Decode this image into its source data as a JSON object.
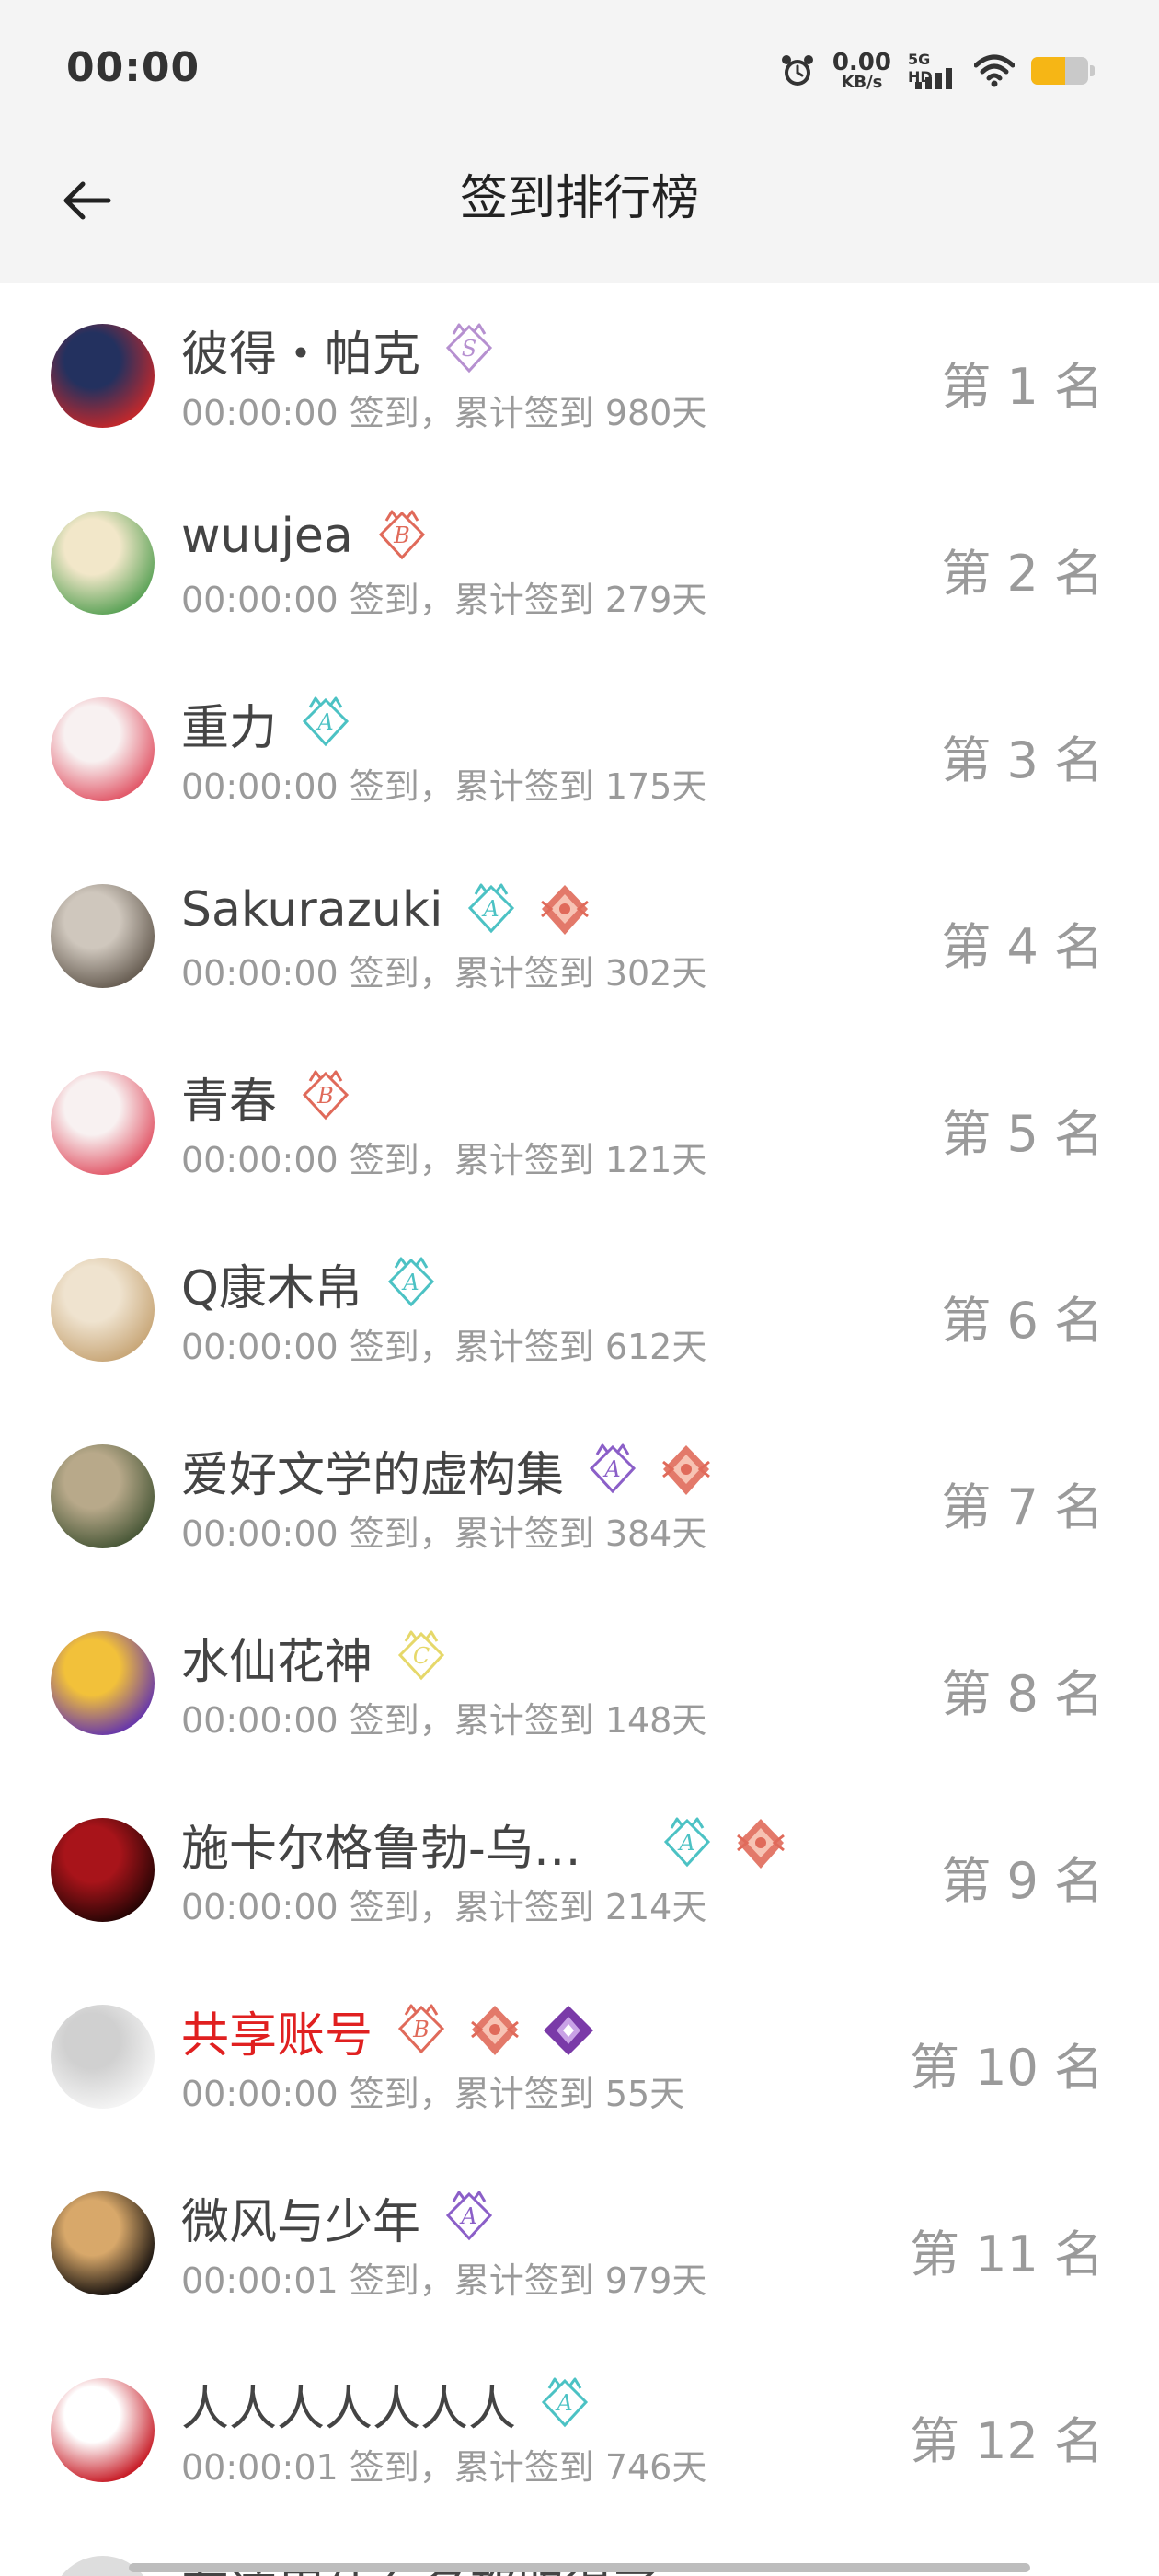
{
  "status_bar": {
    "time": "00:00",
    "net_speed_value": "0.00",
    "net_speed_unit": "KB/s",
    "signal_label": "5G HD",
    "battery_level": 0.6,
    "battery_color": "#f6b615",
    "icons": [
      "alarm-icon",
      "signal-icon",
      "wifi-icon",
      "battery-icon"
    ]
  },
  "header": {
    "back_icon": "arrow-left-icon",
    "title": "签到排行榜"
  },
  "ranking": [
    {
      "name": "彼得・帕克",
      "badges": [
        {
          "type": "rank",
          "letter": "S",
          "color": "#b690d0"
        }
      ],
      "sub": "00:00:00 签到，累计签到 980天",
      "rank": "第 1 名",
      "avatar_colors": [
        "#c0282c",
        "#23315f"
      ]
    },
    {
      "name": "wuujea",
      "badges": [
        {
          "type": "rank",
          "letter": "B",
          "color": "#e06a5a"
        }
      ],
      "sub": "00:00:00 签到，累计签到 279天",
      "rank": "第 2 名",
      "avatar_colors": [
        "#5fa45a",
        "#f2e7c9"
      ]
    },
    {
      "name": "重力",
      "badges": [
        {
          "type": "rank",
          "letter": "A",
          "color": "#4cc2c4"
        }
      ],
      "sub": "00:00:00 签到，累计签到 175天",
      "rank": "第 3 名",
      "avatar_colors": [
        "#e25c6c",
        "#f8f1f1"
      ]
    },
    {
      "name": "Sakurazuki",
      "badges": [
        {
          "type": "rank",
          "letter": "A",
          "color": "#4cc2c4"
        },
        {
          "type": "medal",
          "color": "#e06a5a"
        }
      ],
      "sub": "00:00:00 签到，累计签到 302天",
      "rank": "第 4 名",
      "avatar_colors": [
        "#6a6055",
        "#cfc7bd"
      ]
    },
    {
      "name": "青春",
      "badges": [
        {
          "type": "rank",
          "letter": "B",
          "color": "#e06a5a"
        }
      ],
      "sub": "00:00:00 签到，累计签到 121天",
      "rank": "第 5 名",
      "avatar_colors": [
        "#e25c6c",
        "#f8f1f1"
      ]
    },
    {
      "name": "Q康木帛",
      "badges": [
        {
          "type": "rank",
          "letter": "A",
          "color": "#4cc2c4"
        }
      ],
      "sub": "00:00:00 签到，累计签到 612天",
      "rank": "第 6 名",
      "avatar_colors": [
        "#c9a87a",
        "#efe3cf"
      ]
    },
    {
      "name": "爱好文学的虚构集",
      "badges": [
        {
          "type": "rank",
          "letter": "A",
          "color": "#8b5fc8"
        },
        {
          "type": "medal",
          "color": "#e06a5a"
        }
      ],
      "sub": "00:00:00 签到，累计签到 384天",
      "rank": "第 7 名",
      "avatar_colors": [
        "#4c5a3a",
        "#b8a98a"
      ]
    },
    {
      "name": "水仙花神",
      "badges": [
        {
          "type": "rank",
          "letter": "C",
          "color": "#e6d86a"
        }
      ],
      "sub": "00:00:00 签到，累计签到 148天",
      "rank": "第 8 名",
      "avatar_colors": [
        "#6a3aa8",
        "#f2c13a"
      ]
    },
    {
      "name": "施卡尔格鲁勃-乌…",
      "badges": [
        {
          "type": "rank",
          "letter": "A",
          "color": "#4cc2c4"
        },
        {
          "type": "medal",
          "color": "#e06a5a"
        }
      ],
      "sub": "00:00:00 签到，累计签到 214天",
      "rank": "第 9 名",
      "avatar_colors": [
        "#2a0505",
        "#a8141a"
      ],
      "badges_far": true
    },
    {
      "name": "共享账号",
      "name_color": "red",
      "badges": [
        {
          "type": "rank",
          "letter": "B",
          "color": "#e06a5a"
        },
        {
          "type": "medal",
          "color": "#e06a5a"
        },
        {
          "type": "gem",
          "color": "#7a3aa8"
        }
      ],
      "sub": "00:00:00 签到，累计签到 55天",
      "rank": "第 10 名",
      "avatar_colors": [
        "#f4f4f4",
        "#d0d0d0"
      ]
    },
    {
      "name": "微风与少年",
      "badges": [
        {
          "type": "rank",
          "letter": "A",
          "color": "#8b5fc8"
        }
      ],
      "sub": "00:00:01 签到，累计签到 979天",
      "rank": "第 11 名",
      "avatar_colors": [
        "#1a1410",
        "#d8a86a"
      ]
    },
    {
      "name": "人人人人人人人",
      "badges": [
        {
          "type": "rank",
          "letter": "A",
          "color": "#4cc2c4"
        }
      ],
      "sub": "00:00:01 签到，累计签到 746天",
      "rank": "第 12 名",
      "avatar_colors": [
        "#c8202a",
        "#ffffff"
      ]
    }
  ],
  "partial_row": {
    "name": "有这用什么名都取得了"
  }
}
